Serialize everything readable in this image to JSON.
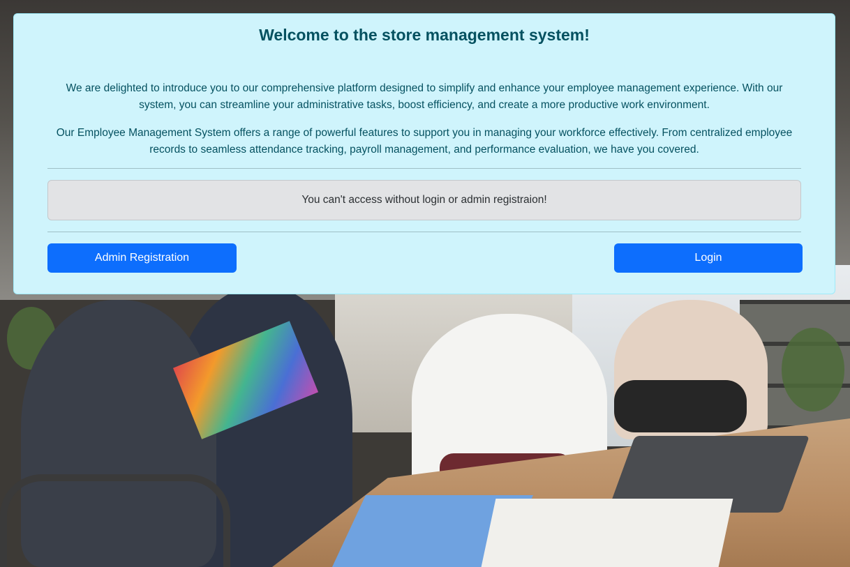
{
  "card": {
    "title": "Welcome to the store management system!",
    "paragraphs": [
      "We are delighted to introduce you to our comprehensive platform designed to simplify and enhance your employee management experience. With our system, you can streamline your administrative tasks, boost efficiency, and create a more productive work environment.",
      "Our Employee Management System offers a range of powerful features to support you in managing your workforce effectively. From centralized employee records to seamless attendance tracking, payroll management, and performance evaluation, we have you covered."
    ],
    "notice": "You can't access without login or admin registraion!",
    "buttons": {
      "admin_registration": "Admin Registration",
      "login": "Login"
    }
  },
  "colors": {
    "card_background": "#cff4fc",
    "card_text": "#055160",
    "notice_background": "#e2e3e5",
    "button_primary": "#0d6efd"
  }
}
